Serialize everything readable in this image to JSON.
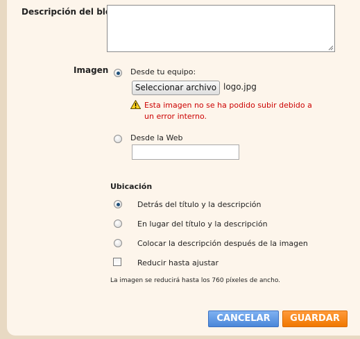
{
  "blog_description": {
    "label": "Descripción del blog",
    "value": ""
  },
  "image": {
    "label": "Imagen",
    "from_computer_label": "Desde tu equipo:",
    "file_button_label": "Seleccionar archivo",
    "file_name": "logo.jpg",
    "error_line1": "Esta imagen no se ha podido subir debido a",
    "error_line2": "un error interno.",
    "from_web_label": "Desde la Web",
    "web_url_value": ""
  },
  "placement": {
    "heading": "Ubicación",
    "options": [
      {
        "label": "Detrás del título y la descripción",
        "checked": true
      },
      {
        "label": "En lugar del título y la descripción",
        "checked": false
      },
      {
        "label": "Colocar la descripción después de la imagen",
        "checked": false
      }
    ],
    "shrink_label": "Reducir hasta ajustar",
    "shrink_note": "La imagen se reducirá hasta los 760 píxeles de ancho."
  },
  "buttons": {
    "cancel": "CANCELAR",
    "save": "GUARDAR"
  },
  "colors": {
    "error": "#cc0000",
    "cancel_button": "#4a86d8",
    "save_button": "#f07800",
    "panel_background": "#fdf5eb",
    "frame_border": "#e8d9c3"
  },
  "icons": {
    "warning": "warning-icon"
  }
}
